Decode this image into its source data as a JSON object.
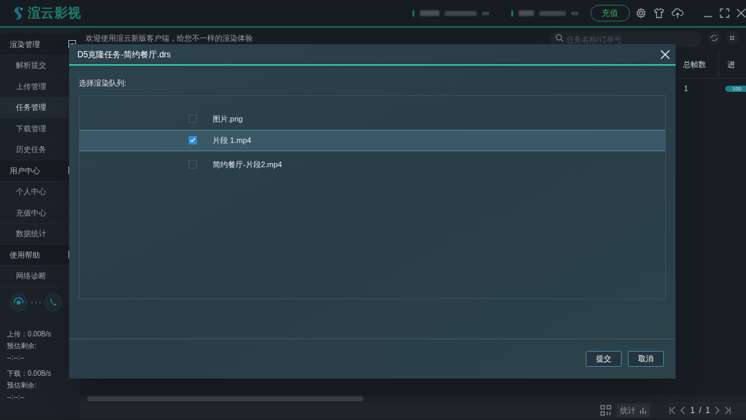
{
  "app": {
    "logo_text": "渲云影视",
    "recharge_button": "充值"
  },
  "sidebar": {
    "groups": [
      {
        "label": "渲染管理",
        "expanded": true,
        "items": [
          {
            "label": "解析提交",
            "selected": false
          },
          {
            "label": "上传管理",
            "selected": false
          },
          {
            "label": "任务管理",
            "selected": true
          },
          {
            "label": "下载管理",
            "selected": false
          },
          {
            "label": "历史任务",
            "selected": false
          }
        ]
      },
      {
        "label": "用户中心",
        "expanded": true,
        "items": [
          {
            "label": "个人中心",
            "selected": false
          },
          {
            "label": "充值中心",
            "selected": false
          },
          {
            "label": "数据统计",
            "selected": false
          }
        ]
      },
      {
        "label": "使用帮助",
        "expanded": true,
        "items": [
          {
            "label": "网络诊断",
            "selected": false
          }
        ]
      }
    ],
    "transfer": [
      {
        "speed": "上传：0.00B/s",
        "remaining_label": "预估剩余:",
        "remaining": "--:--:--"
      },
      {
        "speed": "下载：0.00B/s",
        "remaining_label": "预估剩余:",
        "remaining": "--:--:--"
      }
    ]
  },
  "main": {
    "notice": "欢迎使用渲云新版客户端，给您不一样的渲染体验",
    "search": {
      "placeholder": "任务名称/订单号"
    },
    "table": {
      "columns": [
        "总帧数",
        "进"
      ],
      "rows": [
        {
          "frames": "1",
          "progress": "100",
          "level": 1
        }
      ]
    }
  },
  "footer": {
    "stats_button": "统计",
    "pagination": {
      "current": "1",
      "separator": "/",
      "total": "1"
    }
  },
  "dialog": {
    "title": "D5克隆任务-简约餐厅.drs",
    "prompt": "选择渲染队列:",
    "items": [
      {
        "label": "图片.png",
        "checked": false,
        "selected": false
      },
      {
        "label": "片段 1.mp4",
        "checked": true,
        "selected": true
      },
      {
        "label": "简约餐厅-片段2.mp4",
        "checked": false,
        "selected": false
      }
    ],
    "buttons": [
      "提交",
      "取消"
    ]
  }
}
